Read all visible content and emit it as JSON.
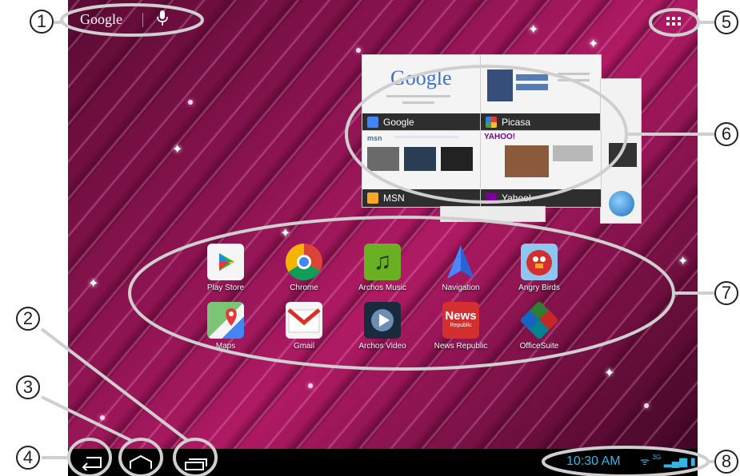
{
  "search": {
    "logo_text": "Google"
  },
  "recent_apps": [
    {
      "label": "Google"
    },
    {
      "label": "Picasa"
    },
    {
      "label": "MSN"
    },
    {
      "label": "Yahoo!"
    }
  ],
  "recent_thumb_text": {
    "google_logo": "Google",
    "yahoo_logo": "YAHOO!",
    "msn_logo": "msn"
  },
  "apps": [
    {
      "label": "Play Store"
    },
    {
      "label": "Chrome"
    },
    {
      "label": "Archos Music"
    },
    {
      "label": "Navigation"
    },
    {
      "label": "Angry Birds"
    },
    {
      "label": "Maps"
    },
    {
      "label": "Gmail"
    },
    {
      "label": "Archos Video"
    },
    {
      "label": "News Republic"
    },
    {
      "label": "OfficeSuite"
    }
  ],
  "app_tile_text": {
    "news": "News",
    "news_sub": "Republic"
  },
  "status": {
    "time": "10:30 AM",
    "network": "3G"
  },
  "callouts": [
    "1",
    "2",
    "3",
    "4",
    "5",
    "6",
    "7",
    "8"
  ],
  "colors": {
    "accent_blue": "#33b5e5",
    "wallpaper_pink": "#b01a65",
    "callout_gray": "#cfcfcf"
  }
}
